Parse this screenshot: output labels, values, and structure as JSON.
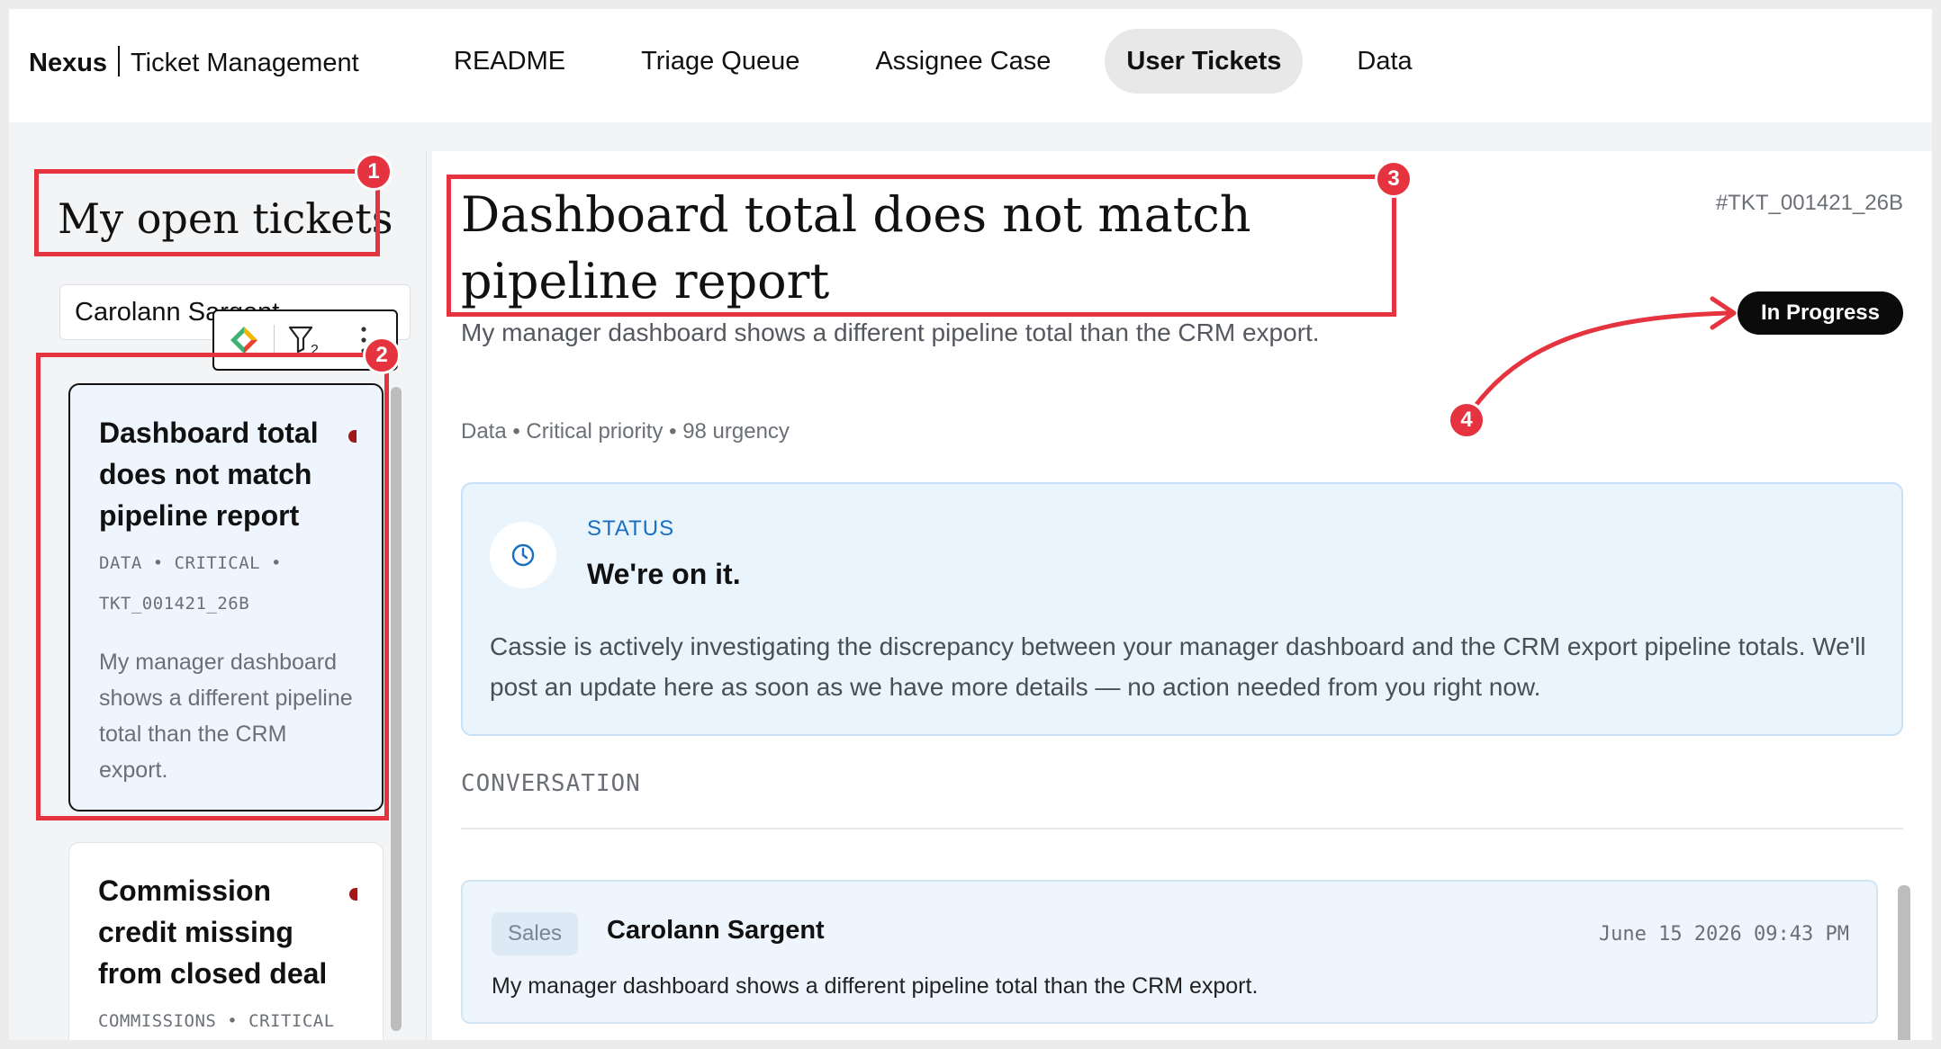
{
  "header": {
    "brand_strong": "Nexus",
    "brand_rest": "Ticket Management",
    "tabs": [
      {
        "label": "README",
        "active": false
      },
      {
        "label": "Triage Queue",
        "active": false
      },
      {
        "label": "Assignee Case",
        "active": false
      },
      {
        "label": "User Tickets",
        "active": true
      },
      {
        "label": "Data",
        "active": false
      }
    ]
  },
  "sidebar": {
    "title": "My open tickets",
    "search_value": "Carolann Sargent",
    "toolbar": {
      "filter_count": "2"
    },
    "tickets": [
      {
        "title": "Dashboard total does not match pipeline report",
        "meta_line1": "DATA • CRITICAL •",
        "meta_line2": "TKT_001421_26B",
        "description": "My manager dashboard shows a different pipeline total than the CRM export.",
        "selected": true
      },
      {
        "title": "Commission credit missing from closed deal",
        "meta_line1": "COMMISSIONS • CRITICAL",
        "selected": false
      }
    ]
  },
  "ticket": {
    "id": "#TKT_001421_26B",
    "title": "Dashboard total does not match pipeline report",
    "status": "In Progress",
    "summary": "My manager dashboard shows a different pipeline total than the CRM export.",
    "meta": "Data • Critical priority • 98 urgency"
  },
  "status_panel": {
    "label": "STATUS",
    "heading": "We're on it.",
    "body": "Cassie is actively investigating the discrepancy between your manager dashboard and the CRM export pipeline totals. We'll post an update here as soon as we have more details — no action needed from you right now."
  },
  "conversation": {
    "label": "CONVERSATION",
    "messages": [
      {
        "department": "Sales",
        "author": "Carolann Sargent",
        "timestamp": "June 15 2026 09:43 PM",
        "text": "My manager dashboard shows a different pipeline total than the CRM export."
      }
    ]
  },
  "annotations": [
    "1",
    "2",
    "3",
    "4"
  ],
  "colors": {
    "annotation": "#e5343f",
    "status_pill": "#0b0b0b",
    "status_panel_bg": "#eaf4fd",
    "status_label": "#1b6fc0",
    "priority_dot": "#a01818"
  }
}
